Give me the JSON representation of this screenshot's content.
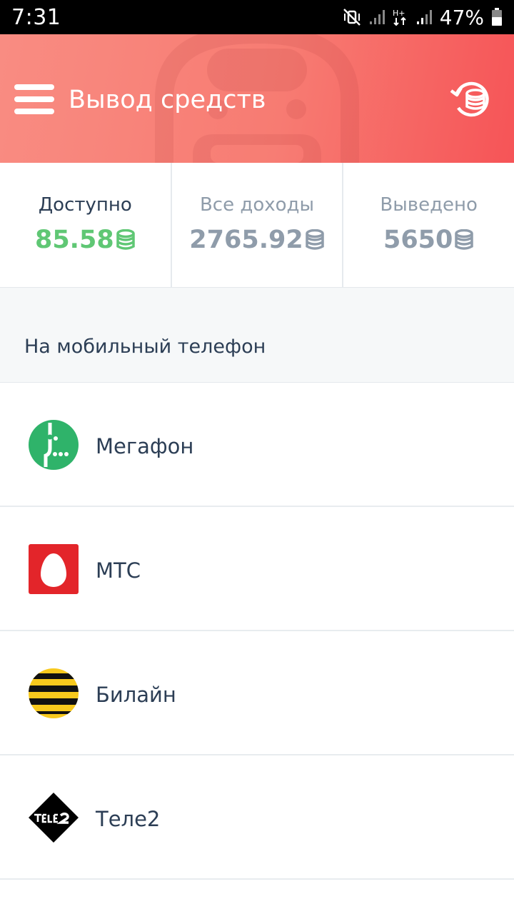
{
  "status_bar": {
    "time": "7:31",
    "battery": "47%",
    "icons": [
      "mute-vibrate-icon",
      "signal-icon",
      "h-plus-data-icon",
      "signal-icon",
      "battery-icon"
    ]
  },
  "header": {
    "title": "Вывод средств",
    "menu_icon": "hamburger-menu-icon",
    "history_icon": "coin-history-icon",
    "colors": {
      "start": "#f98c82",
      "end": "#f65457"
    }
  },
  "stats": [
    {
      "label": "Доступно",
      "value": "85.58",
      "color": "#5fc774"
    },
    {
      "label": "Все доходы",
      "value": "2765.92",
      "color": "#8f9caa"
    },
    {
      "label": "Выведено",
      "value": "5650",
      "color": "#8f9caa"
    }
  ],
  "section": {
    "title": "На мобильный телефон"
  },
  "operators": [
    {
      "name": "Мегафон",
      "logo": "megafon-logo-icon",
      "color": "#2fb36a"
    },
    {
      "name": "МТС",
      "logo": "mts-logo-icon",
      "color": "#e3252a"
    },
    {
      "name": "Билайн",
      "logo": "beeline-logo-icon",
      "color": "#f8c91d"
    },
    {
      "name": "Теле2",
      "logo": "tele2-logo-icon",
      "color": "#000000"
    }
  ]
}
